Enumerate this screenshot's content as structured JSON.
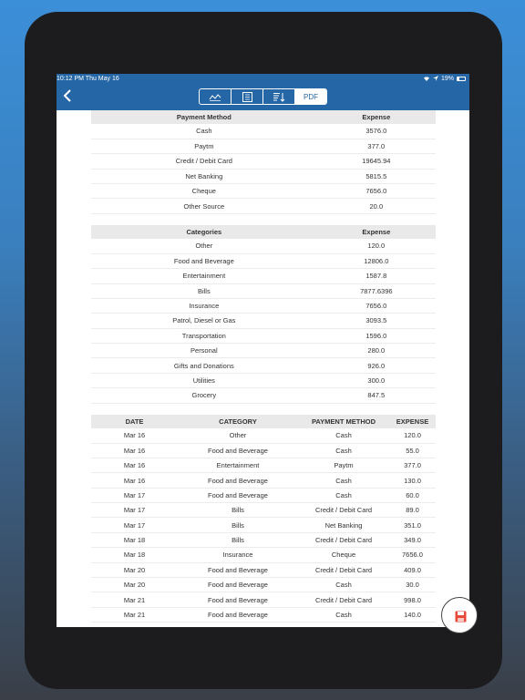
{
  "status": {
    "time": "10:12 PM",
    "day": "Thu May 16",
    "battery": "19%"
  },
  "nav": {
    "active_tab": "PDF"
  },
  "payment_table": {
    "headers": [
      "Payment Method",
      "Expense"
    ],
    "rows": [
      [
        "Cash",
        "3576.0"
      ],
      [
        "Paytm",
        "377.0"
      ],
      [
        "Credit / Debit Card",
        "19645.94"
      ],
      [
        "Net Banking",
        "5815.5"
      ],
      [
        "Cheque",
        "7656.0"
      ],
      [
        "Other Source",
        "20.0"
      ]
    ]
  },
  "category_table": {
    "headers": [
      "Categories",
      "Expense"
    ],
    "rows": [
      [
        "Other",
        "120.0"
      ],
      [
        "Food and Beverage",
        "12806.0"
      ],
      [
        "Entertainment",
        "1587.8"
      ],
      [
        "Bills",
        "7877.6396"
      ],
      [
        "Insurance",
        "7656.0"
      ],
      [
        "Patrol, Diesel or Gas",
        "3093.5"
      ],
      [
        "Transportation",
        "1596.0"
      ],
      [
        "Personal",
        "280.0"
      ],
      [
        "Gifts and Donations",
        "926.0"
      ],
      [
        "Utilities",
        "300.0"
      ],
      [
        "Grocery",
        "847.5"
      ]
    ]
  },
  "transactions_table": {
    "headers": [
      "DATE",
      "CATEGORY",
      "PAYMENT METHOD",
      "EXPENSE"
    ],
    "rows": [
      [
        "Mar 16",
        "Other",
        "Cash",
        "120.0"
      ],
      [
        "Mar 16",
        "Food and Beverage",
        "Cash",
        "55.0"
      ],
      [
        "Mar 16",
        "Entertainment",
        "Paytm",
        "377.0"
      ],
      [
        "Mar 16",
        "Food and Beverage",
        "Cash",
        "130.0"
      ],
      [
        "Mar 17",
        "Food and Beverage",
        "Cash",
        "60.0"
      ],
      [
        "Mar 17",
        "Bills",
        "Credit / Debit Card",
        "89.0"
      ],
      [
        "Mar 17",
        "Bills",
        "Net Banking",
        "351.0"
      ],
      [
        "Mar 18",
        "Bills",
        "Credit / Debit Card",
        "349.0"
      ],
      [
        "Mar 18",
        "Insurance",
        "Cheque",
        "7656.0"
      ],
      [
        "Mar 20",
        "Food and Beverage",
        "Credit / Debit Card",
        "409.0"
      ],
      [
        "Mar 20",
        "Food and Beverage",
        "Cash",
        "30.0"
      ],
      [
        "Mar 21",
        "Food and Beverage",
        "Credit / Debit Card",
        "998.0"
      ],
      [
        "Mar 21",
        "Food and Beverage",
        "Cash",
        "140.0"
      ]
    ]
  },
  "icons": {
    "back": "chevron-left-icon",
    "tab1": "line-chart-icon",
    "tab2": "list-icon",
    "tab3": "sort-icon",
    "fab": "save-icon"
  },
  "colors": {
    "navbar": "#2566a6",
    "fab_icon": "#e8493a"
  }
}
